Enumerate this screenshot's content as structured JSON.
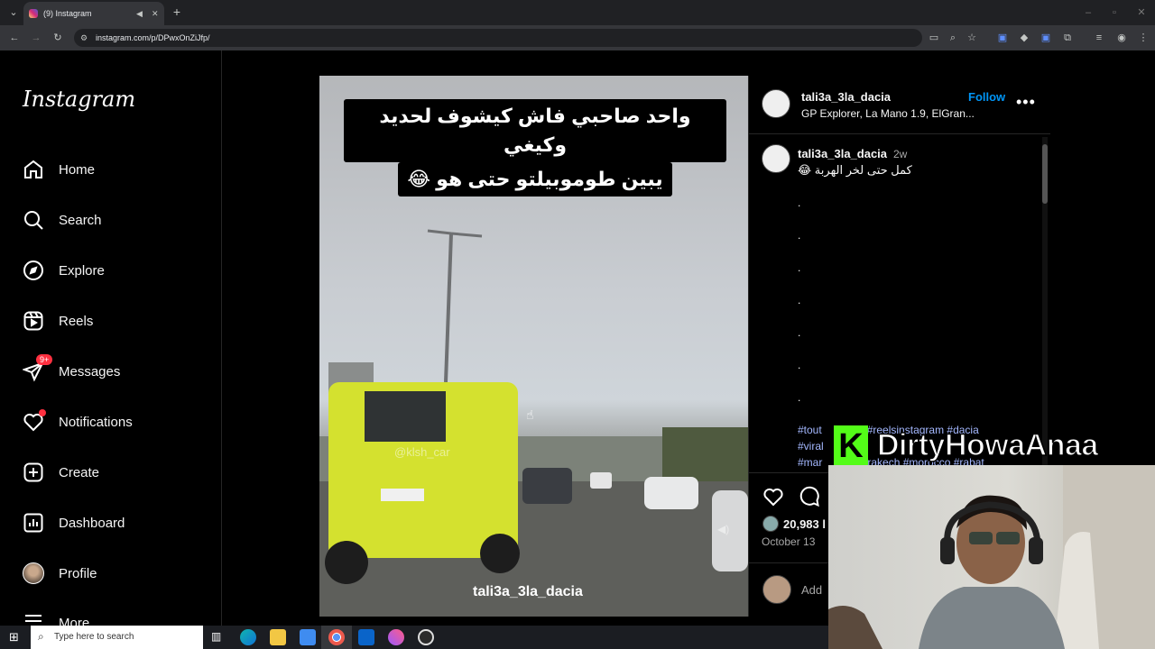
{
  "browser": {
    "tab_title": "(9) Instagram",
    "url": "instagram.com/p/DPwxOnZiJfp/"
  },
  "sidebar": {
    "logo": "Instagram",
    "items": [
      {
        "label": "Home",
        "icon": "home-icon"
      },
      {
        "label": "Search",
        "icon": "search-icon"
      },
      {
        "label": "Explore",
        "icon": "compass-icon"
      },
      {
        "label": "Reels",
        "icon": "reels-icon"
      },
      {
        "label": "Messages",
        "icon": "messenger-icon",
        "badge": "9+"
      },
      {
        "label": "Notifications",
        "icon": "heart-icon",
        "dot": true
      },
      {
        "label": "Create",
        "icon": "plus-square-icon"
      },
      {
        "label": "Dashboard",
        "icon": "dashboard-icon"
      },
      {
        "label": "Profile",
        "icon": "avatar-icon"
      },
      {
        "label": "More",
        "icon": "menu-icon"
      }
    ]
  },
  "post": {
    "video_caption": "واحد صاحبي فاش كيشوف لحديد وكيغي يبين طوموبيلتو حتى هو 😂",
    "video_caption_line1": "واحد صاحبي فاش كيشوف لحديد وكيغي",
    "video_caption_line2": "يبين طوموبيلتو حتى هو 😂",
    "video_username": "tali3a_3la_dacia",
    "video_watermark": "@klsh_car",
    "author": "tali3a_3la_dacia",
    "audio": "GP Explorer, La Mano 1.9, ElGran...",
    "follow_label": "Follow",
    "comment_author": "tali3a_3la_dacia",
    "comment_time": "2w",
    "comment_text": "كمل حتى لخر الهربة 😂",
    "dots": [
      ".",
      ".",
      ".",
      ".",
      ".",
      ".",
      "."
    ],
    "hashtag_line1": "#tout            e #reelsinstagram #dacia",
    "hashtag_line2": "#viral",
    "hashtag_line3": "#mar               rakech #morocco #rabat",
    "likes": "20,983 l",
    "date": "October 13",
    "add_comment": "Add"
  },
  "stream": {
    "badge": "K",
    "name": "DirtyHowaAnaa"
  },
  "taskbar": {
    "search_placeholder": "Type here to search"
  },
  "colors": {
    "accent": "#0095f6",
    "badge_red": "#ff3040",
    "kick_green": "#53fc18"
  }
}
